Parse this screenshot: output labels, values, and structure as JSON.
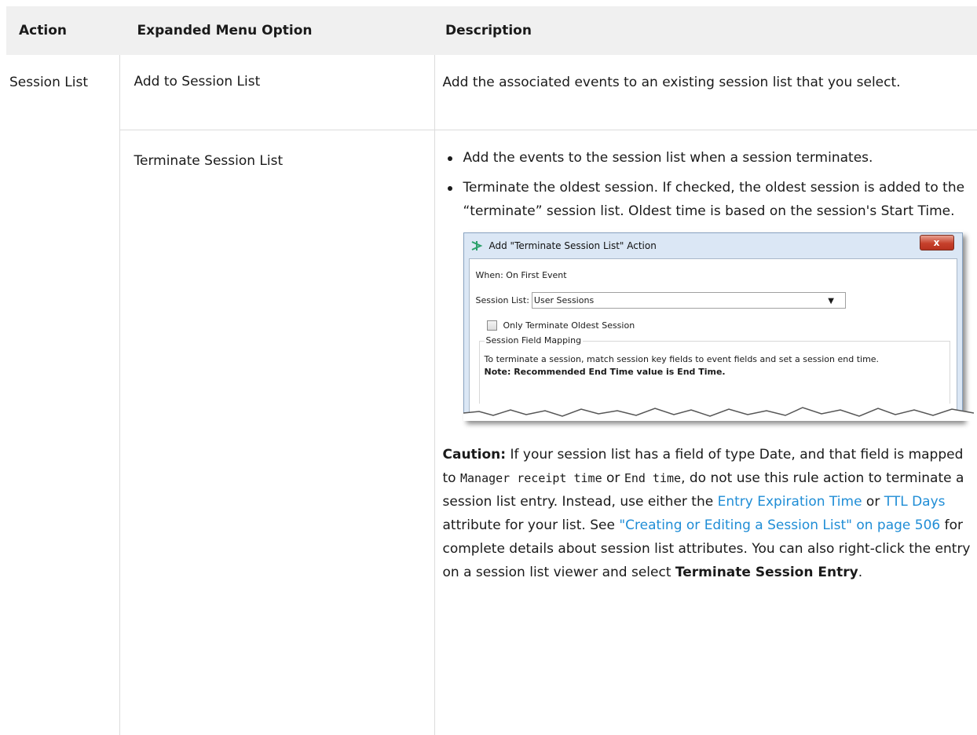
{
  "headers": {
    "action": "Action",
    "expanded": "Expanded Menu Option",
    "description": "Description"
  },
  "rows": [
    {
      "action": "Session List",
      "option": "Add to Session List",
      "description": "Add the associated events to an existing session list that you select."
    },
    {
      "option": "Terminate Session List",
      "bullets": [
        "Add the events to the session list when a session terminates.",
        "Terminate the oldest session. If checked, the oldest session is added to the “terminate” session list. Oldest time is based on the session's Start Time."
      ],
      "dialog": {
        "title": "Add \"Terminate Session List\" Action",
        "close": "x",
        "when": "When: On First Event",
        "session_list_label": "Session List:",
        "session_list_value": "User Sessions",
        "checkbox_label": "Only Terminate Oldest Session",
        "group_legend": "Session Field Mapping",
        "group_text": "To terminate a session, match session key fields to event fields and set a session end time.",
        "group_note": "Note: Recommended End Time value is End Time."
      },
      "caution": {
        "label": "Caution:",
        "t1": " If your session list has a field of type Date, and that field is mapped to ",
        "code1": "Manager receipt time",
        "t2": " or ",
        "code2": "End time",
        "t3": ", do not use this rule action to terminate a session list entry. Instead, use either the ",
        "link1": "Entry Expiration Time",
        "t4": " or ",
        "link2": "TTL Days",
        "t5": " attribute for your list. See ",
        "link3": "\"Creating or Editing a Session List\" on page 506",
        "t6": " for complete details about session list attributes. You can also right-click the entry on a session list viewer and select ",
        "bold_end": "Terminate Session Entry",
        "t7": "."
      }
    }
  ],
  "colors": {
    "header_bg": "#f0f0f0",
    "link": "#1f8dd6",
    "border": "#dcdcdc"
  },
  "icons": {
    "dialog_app": "sparkle-icon",
    "dropdown": "chevron-down-icon"
  }
}
